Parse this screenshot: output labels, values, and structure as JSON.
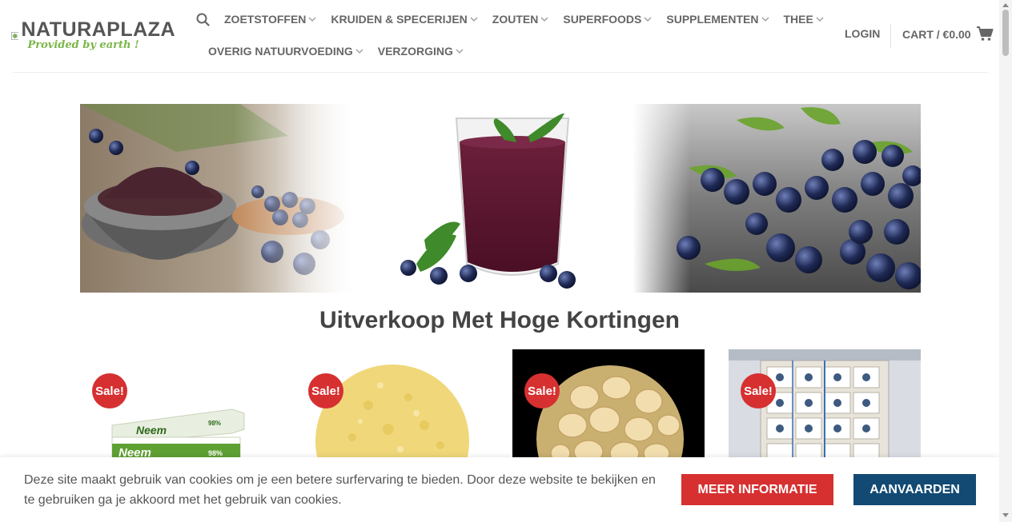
{
  "brand": {
    "name": "NATURAPLAZA",
    "tagline": "Provided by earth !",
    "accent_green": "#7ab648"
  },
  "nav": {
    "search_icon": "search-icon",
    "row1": [
      "ZOETSTOFFEN",
      "KRUIDEN & SPECERIJEN",
      "ZOUTEN",
      "SUPERFOODS",
      "SUPPLEMENTEN",
      "THEE"
    ],
    "row2": [
      "OVERIG NATUURVOEDING",
      "VERZORGING"
    ]
  },
  "account": {
    "login": "LOGIN",
    "cart": "CART / €0.00",
    "cart_icon": "cart-icon"
  },
  "main": {
    "section_title": "Uitverkoop Met Hoge Kortingen",
    "products": [
      {
        "badge": "Sale!",
        "image": "neem toothpaste"
      },
      {
        "badge": "Sale!",
        "image": "yellow powder"
      },
      {
        "badge": "Sale!",
        "image": "macadamia nuts"
      },
      {
        "badge": "Sale!",
        "image": "pallet of boxes"
      }
    ]
  },
  "cookie": {
    "text": "Deze site maakt gebruik van cookies om je een betere surfervaring te bieden. Door deze website te bekijken en te gebruiken ga je akkoord met het gebruik van cookies.",
    "more_info": "MEER INFORMATIE",
    "accept": "AANVAARDEN",
    "red": "#d63031",
    "blue": "#124a73"
  }
}
